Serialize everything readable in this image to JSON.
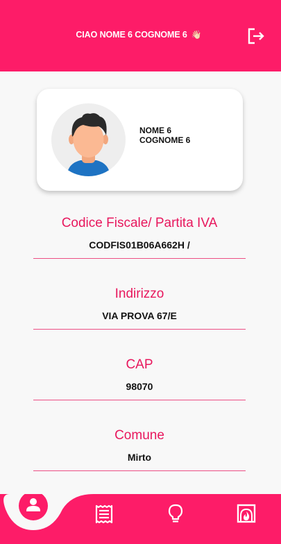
{
  "header": {
    "greeting": "CIAO NOME 6 COGNOME 6",
    "greeting_emoji": "👋🏻",
    "logout_icon": "logout-icon"
  },
  "profile": {
    "first_name": "NOME 6",
    "last_name": "COGNOME 6",
    "avatar_icon": "user-avatar"
  },
  "fields": {
    "tax_code": {
      "label": "Codice Fiscale/ Partita IVA",
      "value": "CODFIS01B06A662H /"
    },
    "address": {
      "label": "Indirizzo",
      "value": "VIA PROVA 67/E"
    },
    "cap": {
      "label": "CAP",
      "value": "98070"
    },
    "comune": {
      "label": "Comune",
      "value": "Mirto"
    }
  },
  "bottom_nav": {
    "items": [
      {
        "icon": "person-icon",
        "active": true
      },
      {
        "icon": "receipt-icon",
        "active": false
      },
      {
        "icon": "lightbulb-icon",
        "active": false
      },
      {
        "icon": "fireplace-icon",
        "active": false
      }
    ]
  },
  "colors": {
    "accent": "#fd1c68",
    "label": "#e8175d",
    "background": "#f8f8f8"
  }
}
